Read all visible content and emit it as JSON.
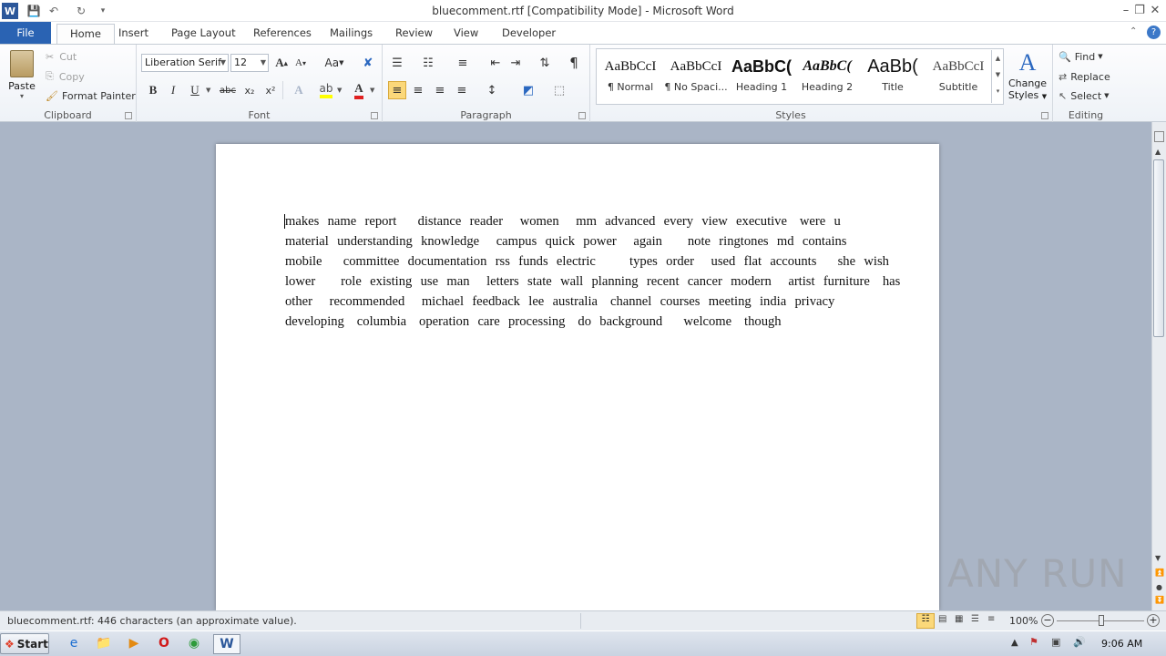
{
  "window": {
    "title": "bluecomment.rtf [Compatibility Mode]  -  Microsoft Word"
  },
  "qat": {
    "app_icon": "word-icon",
    "save": "save-icon",
    "undo": "undo-icon",
    "redo": "redo-icon"
  },
  "tabs": [
    "File",
    "Home",
    "Insert",
    "Page Layout",
    "References",
    "Mailings",
    "Review",
    "View",
    "Developer"
  ],
  "clipboard": {
    "paste": "Paste",
    "cut": "Cut",
    "copy": "Copy",
    "format_painter": "Format Painter",
    "label": "Clipboard"
  },
  "font": {
    "family": "Liberation Serif",
    "size": "12",
    "label": "Font",
    "grow": "A",
    "shrink": "A",
    "case": "Aa",
    "bold": "B",
    "italic": "I",
    "underline": "U",
    "strike": "abc",
    "sub": "x₂",
    "sup": "x²"
  },
  "paragraph": {
    "label": "Paragraph",
    "pilcrow": "¶"
  },
  "styles": {
    "label": "Styles",
    "items": [
      {
        "sample": "AaBbCcI",
        "name": "¶ Normal"
      },
      {
        "sample": "AaBbCcI",
        "name": "¶ No Spaci..."
      },
      {
        "sample": "AaBbC(",
        "name": "Heading 1"
      },
      {
        "sample": "AaBbC(",
        "name": "Heading 2"
      },
      {
        "sample": "AaBb(",
        "name": "Title"
      },
      {
        "sample": "AaBbCcI",
        "name": "Subtitle"
      }
    ],
    "change_line1": "Change",
    "change_line2": "Styles"
  },
  "editing": {
    "label": "Editing",
    "find": "Find",
    "replace": "Replace",
    "select": "Select"
  },
  "document": {
    "lines": [
      "makes  name  report     distance  reader    women    mm  advanced  every  view  executive   were  u",
      "material  understanding  knowledge    campus  quick  power    again      note  ringtones  md  contains",
      "mobile     committee  documentation  rss  funds  electric        types  order    used  flat  accounts     she  wish",
      "lower      role  existing  use  man    letters  state  wall  planning  recent  cancer  modern    artist  furniture   has",
      "other    recommended    michael  feedback  lee  australia   channel  courses  meeting  india  privacy",
      "developing   columbia   operation  care  processing   do  background     welcome   though"
    ]
  },
  "status": {
    "text": "bluecomment.rtf: 446 characters (an approximate value).",
    "zoom": "100%"
  },
  "taskbar": {
    "start": "Start",
    "time": "9:06 AM"
  },
  "watermark": "ANY RUN"
}
